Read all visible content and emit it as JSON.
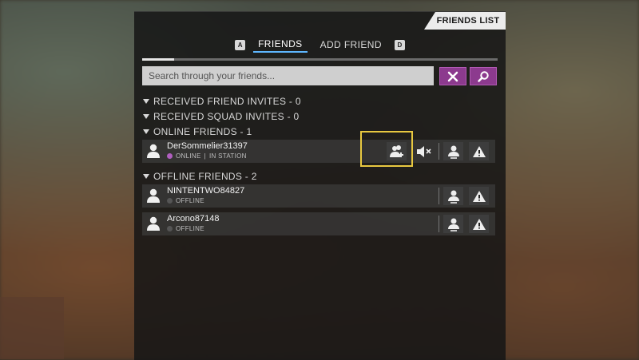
{
  "panel": {
    "title": "FRIENDS LIST"
  },
  "tabs": {
    "left_key": "A",
    "right_key": "D",
    "items": [
      {
        "label": "FRIENDS",
        "active": true
      },
      {
        "label": "ADD FRIEND",
        "active": false
      }
    ]
  },
  "search": {
    "placeholder": "Search through your friends...",
    "value": "",
    "clear_icon": "close-icon",
    "find_icon": "magnifier-icon"
  },
  "sections": {
    "received_friend_invites": "RECEIVED FRIEND INVITES - 0",
    "received_squad_invites": "RECEIVED SQUAD INVITES - 0",
    "online_friends": "ONLINE FRIENDS - 1",
    "offline_friends": "OFFLINE FRIENDS - 2"
  },
  "online_friends": [
    {
      "name": "DerSommelier31397",
      "status": "ONLINE",
      "location": "IN STATION"
    }
  ],
  "offline_friends": [
    {
      "name": "NINTENTWO84827",
      "status": "OFFLINE"
    },
    {
      "name": "Arcono87148",
      "status": "OFFLINE"
    }
  ],
  "colors": {
    "accent_purple": "#8c3a8e",
    "tab_underline": "#5eb7ff",
    "highlight": "#e8c840",
    "online_dot": "#b05fbf"
  }
}
